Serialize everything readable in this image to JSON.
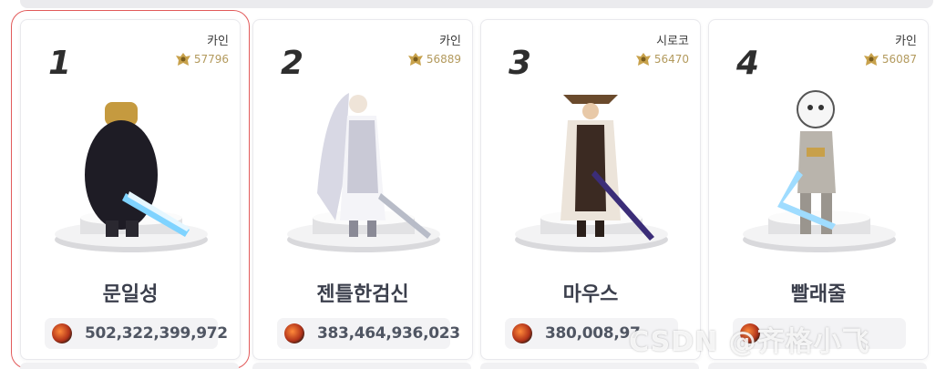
{
  "cards": [
    {
      "rank": "1",
      "server": "카인",
      "fame": "57796",
      "name": "문일성",
      "power": "502,322,399,972",
      "selected": true
    },
    {
      "rank": "2",
      "server": "카인",
      "fame": "56889",
      "name": "젠틀한검신",
      "power": "383,464,936,023",
      "selected": false
    },
    {
      "rank": "3",
      "server": "시로코",
      "fame": "56470",
      "name": "마우스",
      "power": "380,008,97",
      "selected": false
    },
    {
      "rank": "4",
      "server": "카인",
      "fame": "56087",
      "name": "빨래줄",
      "power": "",
      "selected": false
    }
  ],
  "watermark": "CSDN @齐格小飞",
  "colors": {
    "selected_outline": "#e25a5a",
    "fame_gold": "#b39a5d",
    "name_text": "#3b3f4c"
  },
  "icons": {
    "fame": "fame-crest-icon",
    "power": "power-orb-icon"
  }
}
